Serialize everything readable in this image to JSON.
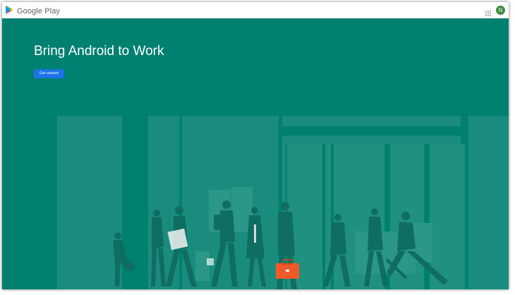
{
  "header": {
    "brand": "Google Play",
    "logo_icon": "google-play-logo-icon",
    "apps_icon": "apps-grid-icon",
    "avatar_initial": "N"
  },
  "hero": {
    "title": "Bring Android to Work",
    "cta_label": "Get started",
    "background_color": "#00806f",
    "cta_color": "#1a73e8",
    "illustration": "people-walking-to-work-illustration",
    "briefcase_color": "#f05a28"
  }
}
